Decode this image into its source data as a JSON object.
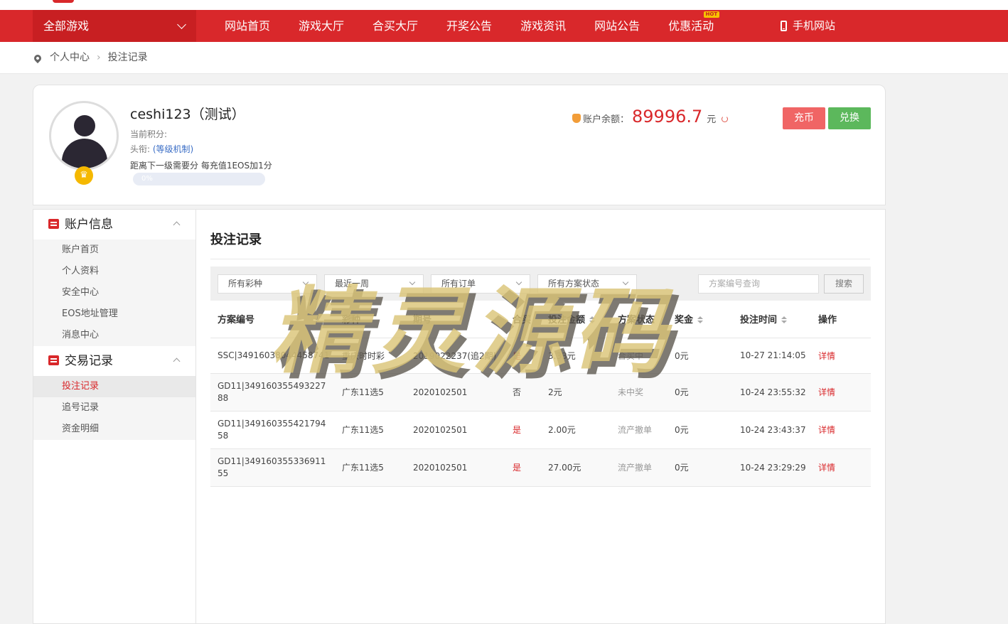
{
  "nav": {
    "all_games": "全部游戏",
    "links": [
      "网站首页",
      "游戏大厅",
      "合买大厅",
      "开奖公告",
      "游戏资讯",
      "网站公告",
      "优惠活动"
    ],
    "hot_badge": "HOT",
    "mobile": "手机网站"
  },
  "breadcrumb": {
    "home": "个人中心",
    "current": "投注记录"
  },
  "profile": {
    "username": "ceshi123（测试）",
    "points_label": "当前积分:",
    "title_label": "头衔:",
    "title_link": "(等级机制)",
    "next_level": "距离下一级需要分 每充值1EOS加1分",
    "progress": "0%",
    "balance_label": "账户余额：",
    "balance_value": "89996.7",
    "balance_unit": "元",
    "recharge": "充币",
    "exchange": "兑换"
  },
  "sidebar": {
    "group1": "账户信息",
    "group1_items": [
      "账户首页",
      "个人资料",
      "安全中心",
      "EOS地址管理",
      "消息中心"
    ],
    "group2": "交易记录",
    "group2_items": [
      "投注记录",
      "追号记录",
      "资金明细"
    ]
  },
  "main": {
    "title": "投注记录",
    "filters": [
      "所有彩种",
      "最近一周",
      "所有订单",
      "所有方案状态"
    ],
    "search_placeholder": "方案编号查询",
    "search_button": "搜索",
    "columns": [
      "方案编号",
      "彩种",
      "期号",
      "合买",
      "投注金额",
      "方案状态",
      "奖金",
      "投注时间",
      "操作"
    ],
    "rows": [
      {
        "code": "SSC|3491603804445874​1",
        "lottery": "重庆时时彩",
        "issue": "2019022237(追2期)",
        "joint": "是",
        "amount": "3.33元",
        "status": "合买中",
        "prize": "0元",
        "time": "10-27 21:14:05",
        "action": "详情"
      },
      {
        "code": "GD11|34916035549322788",
        "lottery": "广东11选5",
        "issue": "2020102501",
        "joint": "否",
        "amount": "2元",
        "status": "未中奖",
        "prize": "0元",
        "time": "10-24 23:55:32",
        "action": "详情"
      },
      {
        "code": "GD11|34916035542179458",
        "lottery": "广东11选5",
        "issue": "2020102501",
        "joint": "是",
        "amount": "2.00元",
        "status": "流产撤单",
        "prize": "0元",
        "time": "10-24 23:43:37",
        "action": "详情"
      },
      {
        "code": "GD11|34916035533691155",
        "lottery": "广东11选5",
        "issue": "2020102501",
        "joint": "是",
        "amount": "27.00元",
        "status": "流产撤单",
        "prize": "0元",
        "time": "10-24 23:29:29",
        "action": "详情"
      }
    ]
  },
  "watermark": "精灵源码"
}
